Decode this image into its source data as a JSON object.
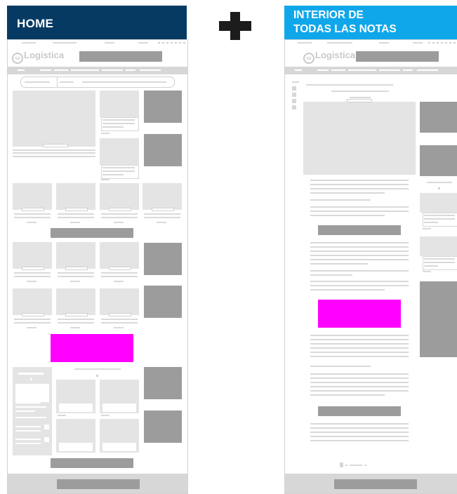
{
  "left_panel": {
    "title": "HOME",
    "logo_text": "Logistica",
    "logo_mark": "ω",
    "accent": "#073a63"
  },
  "right_panel": {
    "title": "INTERIOR DE\nTODAS LAS NOTAS",
    "logo_text": "Logistica",
    "logo_mark": "ω",
    "accent": "#0fa7ea"
  },
  "colors": {
    "ad_slot": "#ff00ff",
    "block": "#9c9c9c",
    "image": "#e4e4e4",
    "plus": "#1c1c1c"
  }
}
